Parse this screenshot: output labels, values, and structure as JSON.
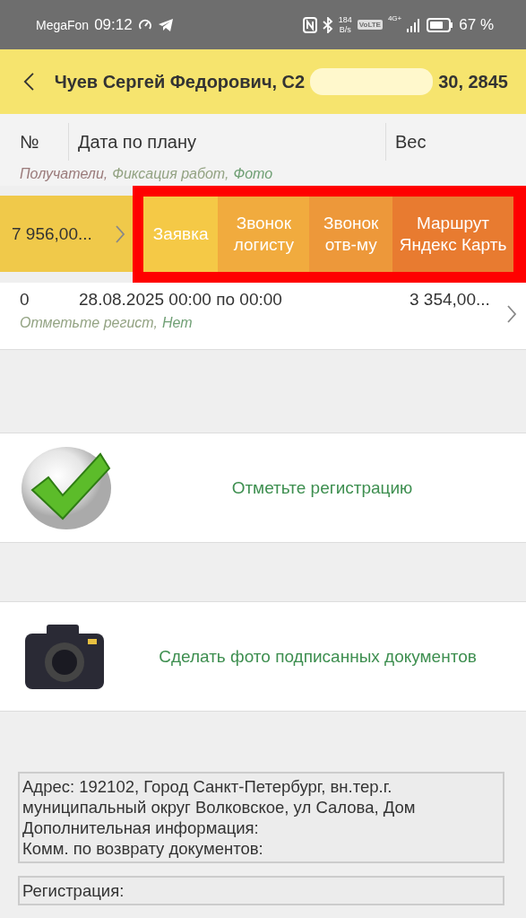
{
  "status_bar": {
    "carrier": "MegaFon",
    "time": "09:12",
    "speed_value": "184",
    "speed_unit": "B/s",
    "volte": "VoLTE",
    "network": "4G+",
    "battery": "67 %"
  },
  "header": {
    "title_start": "Чуев Сергей Федорович, С2",
    "title_end": "30, 2845"
  },
  "columns": [
    "№",
    "Дата по плану",
    "Вес"
  ],
  "column_links": [
    {
      "label": "Получатели,",
      "color": "#9a7a7a"
    },
    {
      "label": "Фиксация работ,",
      "color": "#93a383"
    },
    {
      "label": "Фото",
      "color": "#6f9f74"
    }
  ],
  "swiped_row": {
    "weight": "7 956,00...",
    "highlighted": true,
    "actions": [
      {
        "label": "Заявка",
        "color": "#f5c946"
      },
      {
        "label": "Звонок логисту",
        "color": "#f1ab3e"
      },
      {
        "label": "Звонок отв-му",
        "color": "#ed983a"
      },
      {
        "label": "Маршрут Яндекс Карть",
        "color": "#e87b30"
      }
    ]
  },
  "rows": [
    {
      "number": "0",
      "date": "28.08.2025 00:00 по 00:00",
      "weight": "3 354,00...",
      "links": [
        {
          "label": "Отметьте регист,",
          "color": "#93a383"
        },
        {
          "label": "Нет",
          "color": "#6f9f74"
        }
      ]
    }
  ],
  "actions": [
    {
      "kind": "check",
      "label": "Отметьте регистрацию"
    },
    {
      "kind": "camera",
      "label": "Сделать фото подписанных документов"
    }
  ],
  "info_boxes": [
    {
      "lines": [
        "Адрес: 192102, Город Санкт-Петербург, вн.тер.г. муниципальный округ Волковское, ул Салова, Дом",
        "Дополнительная информация:",
        "Комм. по возврату документов:"
      ]
    },
    {
      "lines": [
        "Регистрация:"
      ]
    }
  ]
}
